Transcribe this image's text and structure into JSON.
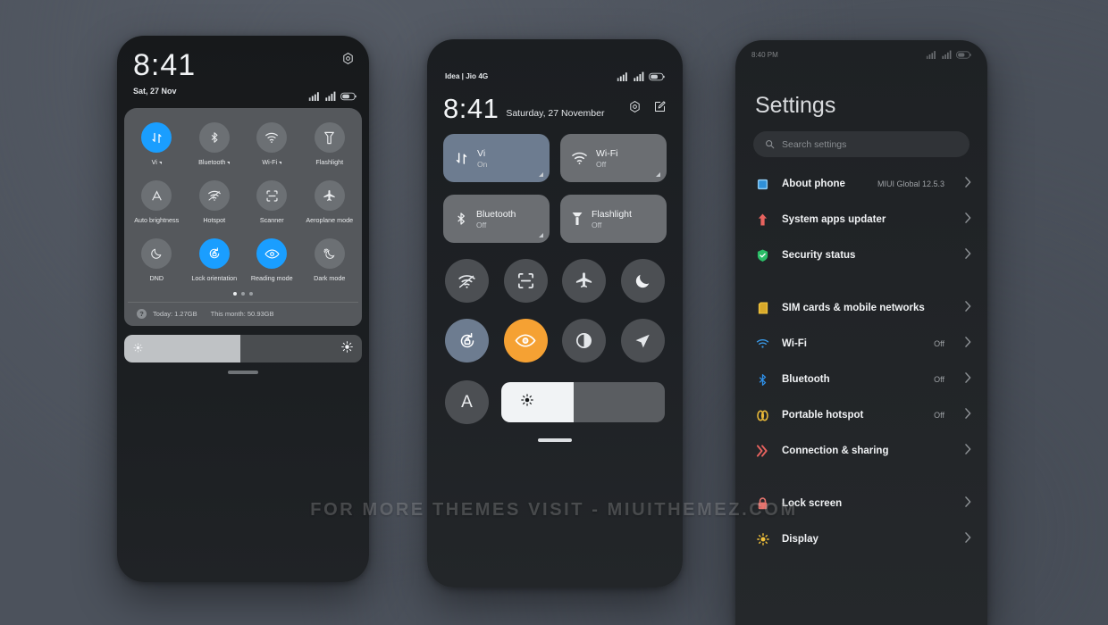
{
  "watermark": "FOR MORE THEMES VISIT - MIUITHEMEZ.COM",
  "colors": {
    "background": "#4c525c",
    "accent_blue": "#1a9eff",
    "accent_amber": "#f5a133",
    "slate_tile": "#6d7c90",
    "panel_gray": "#55585c"
  },
  "phone1": {
    "clock": "8:41",
    "date": "Sat, 27 Nov",
    "tiles": [
      {
        "label": "Vi",
        "icon": "mobile-data-icon",
        "state": "on",
        "expandable": true
      },
      {
        "label": "Bluetooth",
        "icon": "bluetooth-icon",
        "state": "off",
        "expandable": true
      },
      {
        "label": "Wi-Fi",
        "icon": "wifi-icon",
        "state": "off",
        "expandable": true
      },
      {
        "label": "Flashlight",
        "icon": "flashlight-icon",
        "state": "off",
        "expandable": false
      },
      {
        "label": "Auto brightness",
        "icon": "auto-brightness-icon",
        "state": "off",
        "expandable": false
      },
      {
        "label": "Hotspot",
        "icon": "hotspot-icon",
        "state": "off",
        "expandable": false
      },
      {
        "label": "Scanner",
        "icon": "scanner-icon",
        "state": "off",
        "expandable": false
      },
      {
        "label": "Aeroplane mode",
        "icon": "aeroplane-icon",
        "state": "off",
        "expandable": false
      },
      {
        "label": "DND",
        "icon": "moon-icon",
        "state": "off",
        "expandable": false
      },
      {
        "label": "Lock orientation",
        "icon": "rotation-lock-icon",
        "state": "on",
        "expandable": false
      },
      {
        "label": "Reading mode",
        "icon": "eye-icon",
        "state": "on",
        "expandable": false
      },
      {
        "label": "Dark mode",
        "icon": "dark-mode-icon",
        "state": "off",
        "expandable": false
      }
    ],
    "pager": {
      "total": 3,
      "active": 1
    },
    "usage": {
      "today_label": "Today: 1.27GB",
      "month_label": "This month: 50.93GB",
      "help_glyph": "?"
    },
    "brightness_percent": 49
  },
  "phone2": {
    "carrier": "Idea | Jio 4G",
    "clock": "8:41",
    "date": "Saturday, 27 November",
    "big_tiles": [
      {
        "title": "Vi",
        "status": "On",
        "icon": "mobile-data-icon",
        "state": "on",
        "expandable": true
      },
      {
        "title": "Wi-Fi",
        "status": "Off",
        "icon": "wifi-icon",
        "state": "off",
        "expandable": true
      },
      {
        "title": "Bluetooth",
        "status": "Off",
        "icon": "bluetooth-icon",
        "state": "off",
        "expandable": true
      },
      {
        "title": "Flashlight",
        "status": "Off",
        "icon": "flashlight-icon",
        "state": "off",
        "expandable": false
      }
    ],
    "circle_tiles_row1": [
      {
        "icon": "hotspot-icon",
        "state": "off"
      },
      {
        "icon": "scanner-icon",
        "state": "off"
      },
      {
        "icon": "aeroplane-icon",
        "state": "off"
      },
      {
        "icon": "moon-icon",
        "state": "off"
      }
    ],
    "circle_tiles_row2": [
      {
        "icon": "rotation-lock-icon",
        "state": "on-slate"
      },
      {
        "icon": "eye-icon",
        "state": "on-amber"
      },
      {
        "icon": "contrast-icon",
        "state": "off"
      },
      {
        "icon": "location-icon",
        "state": "off"
      }
    ],
    "auto_brightness_label": "A",
    "brightness_percent": 44
  },
  "phone3": {
    "status_time": "8:40 PM",
    "title": "Settings",
    "search_placeholder": "Search settings",
    "items": [
      {
        "label": "About phone",
        "value": "MIUI Global 12.5.3",
        "icon": "about-phone-icon",
        "color": "#4aa8e8"
      },
      {
        "label": "System apps updater",
        "value": "",
        "icon": "updater-arrow-icon",
        "color": "#e8635f"
      },
      {
        "label": "Security status",
        "value": "",
        "icon": "shield-check-icon",
        "color": "#30c06a"
      },
      {
        "divider": true
      },
      {
        "label": "SIM cards & mobile networks",
        "value": "",
        "icon": "sim-card-icon",
        "color": "#e8b838"
      },
      {
        "label": "Wi-Fi",
        "value": "Off",
        "icon": "wifi-icon",
        "color": "#3a9ae8"
      },
      {
        "label": "Bluetooth",
        "value": "Off",
        "icon": "bluetooth-icon",
        "color": "#3a9ae8"
      },
      {
        "label": "Portable hotspot",
        "value": "Off",
        "icon": "hotspot-link-icon",
        "color": "#e8b838"
      },
      {
        "label": "Connection & sharing",
        "value": "",
        "icon": "connection-sharing-icon",
        "color": "#e8635f"
      },
      {
        "divider": true
      },
      {
        "label": "Lock screen",
        "value": "",
        "icon": "lock-icon",
        "color": "#e8756f"
      },
      {
        "label": "Display",
        "value": "",
        "icon": "display-sun-icon",
        "color": "#e8b838"
      }
    ]
  }
}
